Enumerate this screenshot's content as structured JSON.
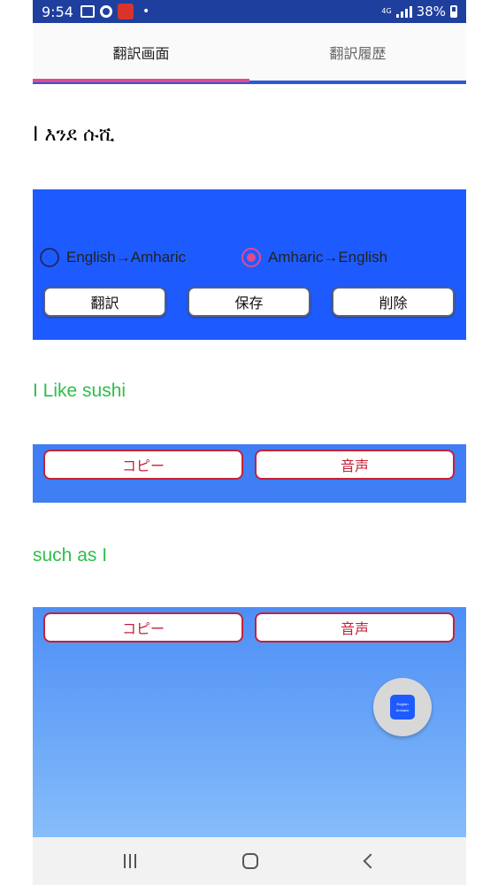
{
  "status_bar": {
    "time": "9:54",
    "dot": "•",
    "network": "4G",
    "battery": "38%"
  },
  "tabs": [
    {
      "label": "翻訳画面",
      "active": true
    },
    {
      "label": "翻訳履歴",
      "active": false
    }
  ],
  "source_text": "I እንደ ሱሺ",
  "control_panel": {
    "radio_en_am": "English→Amharic",
    "radio_am_en": "Amharic→English",
    "selected": "Amharic→English",
    "translate_label": "翻訳",
    "save_label": "保存",
    "delete_label": "削除"
  },
  "result1": {
    "text": "I Like sushi",
    "copy_label": "コピー",
    "speech_label": "音声"
  },
  "result2": {
    "text": "such as I",
    "copy_label": "コピー",
    "speech_label": "音声"
  },
  "fab": {
    "icon_line1": "English",
    "icon_line2": "Amharic"
  },
  "colors": {
    "status_bar": "#1f3f9e",
    "panel_blue": "#1e5bff",
    "accent_pink": "#e24a8e",
    "result_green": "#2fbe4b",
    "button_red": "#c4213a"
  }
}
